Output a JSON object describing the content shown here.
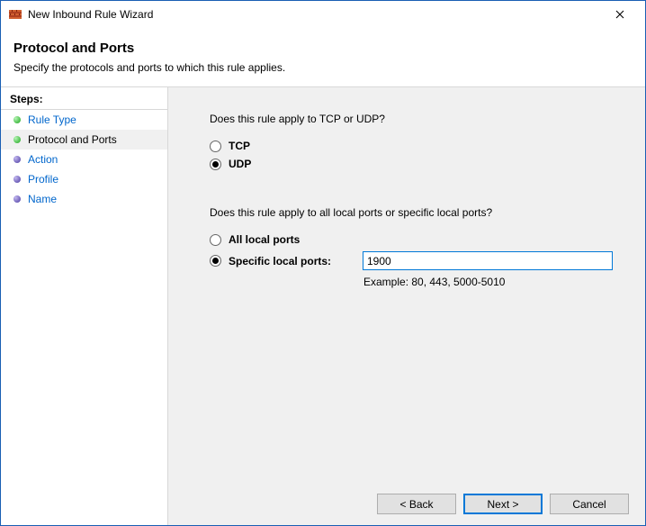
{
  "window": {
    "title": "New Inbound Rule Wizard"
  },
  "header": {
    "title": "Protocol and Ports",
    "description": "Specify the protocols and ports to which this rule applies."
  },
  "sidebar": {
    "heading": "Steps:",
    "items": [
      {
        "label": "Rule Type",
        "state": "done"
      },
      {
        "label": "Protocol and Ports",
        "state": "current"
      },
      {
        "label": "Action",
        "state": "pending"
      },
      {
        "label": "Profile",
        "state": "pending"
      },
      {
        "label": "Name",
        "state": "pending"
      }
    ]
  },
  "content": {
    "protocol_question": "Does this rule apply to TCP or UDP?",
    "protocol_options": {
      "tcp": "TCP",
      "udp": "UDP"
    },
    "protocol_selected": "udp",
    "ports_question": "Does this rule apply to all local ports or specific local ports?",
    "ports_options": {
      "all": "All local ports",
      "specific": "Specific local ports:"
    },
    "ports_selected": "specific",
    "ports_value": "1900",
    "ports_example": "Example: 80, 443, 5000-5010"
  },
  "buttons": {
    "back": "< Back",
    "next": "Next >",
    "cancel": "Cancel"
  }
}
